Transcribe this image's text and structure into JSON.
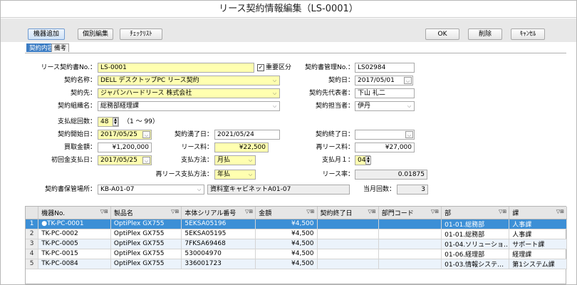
{
  "window": {
    "title": "リース契約情報編集（LS-0001）"
  },
  "toolbar": {
    "add_equipment": "機器追加",
    "edit_individual": "個別編集",
    "checklist": "ﾁｪｯｸﾘｽﾄ",
    "ok": "OK",
    "delete": "削除",
    "cancel": "ｷｬﾝｾﾙ"
  },
  "tabs": [
    {
      "label": "契約内容"
    },
    {
      "label": "備考"
    }
  ],
  "form": {
    "contract_no": {
      "label": "リース契約書No.：",
      "value": "LS-0001"
    },
    "priority": {
      "label": "重要区分",
      "checked": true
    },
    "doc_no": {
      "label": "契約書管理No.：",
      "value": "LS02984"
    },
    "contract_name": {
      "label": "契約名称：",
      "value": "DELL デスクトップPC リース契約"
    },
    "contract_date": {
      "label": "契約日：",
      "value": "2017/05/01"
    },
    "contractor": {
      "label": "契約先：",
      "value": "ジャパンハードリース 株式会社"
    },
    "contractor_rep": {
      "label": "契約先代表者：",
      "value": "下山 礼二"
    },
    "org": {
      "label": "契約組織名：",
      "value": "総務部経理課"
    },
    "person": {
      "label": "契約担当者：",
      "value": "伊丹"
    },
    "payment_count": {
      "label": "支払総回数：",
      "value": "48",
      "range": "（1 ～ 99）"
    },
    "start_date": {
      "label": "契約開始日：",
      "value": "2017/05/25"
    },
    "expiry_date": {
      "label": "契約満了日：",
      "value": "2021/05/24"
    },
    "end_date": {
      "label": "契約終了日：",
      "value": ""
    },
    "purchase": {
      "label": "買取金額：",
      "value": "¥1,200,000"
    },
    "lease_fee": {
      "label": "リース料：",
      "value": "¥22,500"
    },
    "release_fee": {
      "label": "再リース料：",
      "value": "¥27,000"
    },
    "first_pay": {
      "label": "初回金支払日：",
      "value": "2017/05/25"
    },
    "pay_method": {
      "label": "支払方法：",
      "value": "月払"
    },
    "pay_month": {
      "label": "支払月１：",
      "value": "04"
    },
    "repay_method": {
      "label": "再リース支払方法：",
      "value": "年払"
    },
    "rate": {
      "label": "リース率：",
      "value": "0.01875"
    },
    "storage": {
      "label": "契約書保管場所：",
      "value": "KB-A01-07",
      "desc": "資料室キャビネットA01-07"
    },
    "current_count": {
      "label": "当月回数：",
      "value": "3"
    }
  },
  "grid": {
    "headers": [
      "機器No.",
      "製品名",
      "本体シリアル番号",
      "金額",
      "契約終了日",
      "部門コード",
      "部",
      "課"
    ],
    "rows": [
      {
        "no": "1",
        "id": "●TK-PC-0001",
        "product": "OptiPlex GX755",
        "serial": "5EKSA05196",
        "amount": "¥4,500",
        "end": "",
        "dept_code": "",
        "dept": "01-01.総務部",
        "section": "人事課"
      },
      {
        "no": "2",
        "id": "TK-PC-0002",
        "product": "OptiPlex GX755",
        "serial": "5EKSA05195",
        "amount": "¥4,500",
        "end": "",
        "dept_code": "",
        "dept": "01-01.総務部",
        "section": "人事課"
      },
      {
        "no": "3",
        "id": "TK-PC-0005",
        "product": "OptiPlex GX755",
        "serial": "7FKSA69468",
        "amount": "¥4,500",
        "end": "",
        "dept_code": "",
        "dept": "01-04.ソリューショ…",
        "section": "サポート課"
      },
      {
        "no": "4",
        "id": "TK-PC-0015",
        "product": "OptiPlex GX755",
        "serial": "530004970",
        "amount": "¥4,500",
        "end": "",
        "dept_code": "",
        "dept": "01-06.経理部",
        "section": "経理課"
      },
      {
        "no": "5",
        "id": "TK-PC-0084",
        "product": "OptiPlex GX755",
        "serial": "336001723",
        "amount": "¥4,500",
        "end": "",
        "dept_code": "",
        "dept": "01-03.情報システ…",
        "section": "第1システム課"
      }
    ]
  }
}
